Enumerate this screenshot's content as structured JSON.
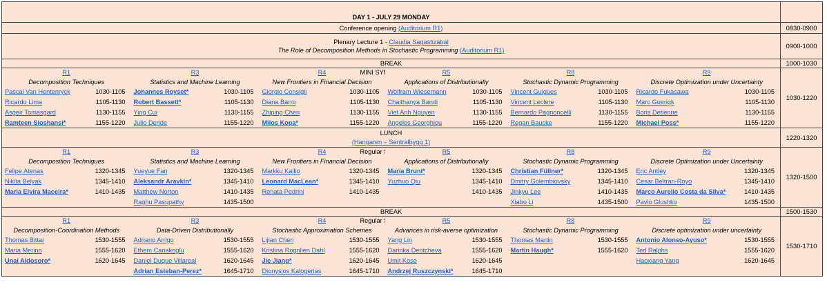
{
  "day_title": "DAY 1 - JULY 29 MONDAY",
  "opening": {
    "text": "Conference opening",
    "room": "(Auditorium R1)",
    "time": "0830-0900"
  },
  "plenary": {
    "line1_prefix": "Plenary Lecture 1 -",
    "speaker": "Claudia Sagastizábal",
    "title": "The Role of Decomposition Methods in Stochastic Programming",
    "room": "(Auditorium R1)",
    "time": "0900-1000"
  },
  "break1": {
    "label": "BREAK",
    "time": "1000-1030"
  },
  "block1": {
    "center": "MINI SYMPOSIA",
    "time": "1030-1220",
    "rooms": [
      "R1",
      "R3",
      "R4",
      "R5",
      "R8",
      "R9"
    ],
    "tracks": [
      "Decomposition Techniques",
      "Statistics and Machine Learning",
      "New Frontiers in Financial Decision",
      "Applications of Distributionally",
      "Stochastic Dynamic Programming",
      "Discrete Optimization under Uncertainty"
    ],
    "rows": [
      [
        {
          "n": "Pascal Van Hentenryck",
          "t": "1030-1105"
        },
        {
          "n": "Johannes Royset*",
          "t": "1030-1105",
          "b": true
        },
        {
          "n": "Giorgio Consigli",
          "t": "1030-1105"
        },
        {
          "n": "Wolfram Wiesemann",
          "t": "1030-1105"
        },
        {
          "n": "Vincent Guigues",
          "t": "1030-1105"
        },
        {
          "n": "Ricardo Fukasawa",
          "t": "1030-1105"
        }
      ],
      [
        {
          "n": "Ricardo Lima",
          "t": "1105-1130"
        },
        {
          "n": "Robert Bassett*",
          "t": "1105-1130",
          "b": true
        },
        {
          "n": "Diana Barro",
          "t": "1105-1130"
        },
        {
          "n": "Chaithanya Bandi",
          "t": "1105-1130"
        },
        {
          "n": "Vincent Leclere",
          "t": "1105-1130"
        },
        {
          "n": "Marc Goerigk",
          "t": "1105-1130"
        }
      ],
      [
        {
          "n": "Asgeir Tomasgard",
          "t": "1130-1155"
        },
        {
          "n": "Ying Cui",
          "t": "1130-1155"
        },
        {
          "n": "Zhiping Chen",
          "t": "1130-1155"
        },
        {
          "n": "Viet Anh Nguyen",
          "t": "1130-1155"
        },
        {
          "n": "Bernardo Pagnoncelli",
          "t": "1130-1155"
        },
        {
          "n": "Boris Detienne",
          "t": "1130-1155"
        }
      ],
      [
        {
          "n": "Ramteen Sioshansi*",
          "t": "1155-1220",
          "b": true
        },
        {
          "n": "Julio Deride",
          "t": "1155-1220"
        },
        {
          "n": "Milos Kopa*",
          "t": "1155-1220",
          "b": true
        },
        {
          "n": "Angelos Georghiou",
          "t": "1155-1220"
        },
        {
          "n": "Regan Baucke",
          "t": "1155-1220"
        },
        {
          "n": "Michael Poss*",
          "t": "1155-1220",
          "b": true
        }
      ]
    ]
  },
  "lunch": {
    "label": "LUNCH",
    "place": "(Hangaren – Sentralbygg 1)",
    "time": "1220-1320"
  },
  "block2": {
    "center": "Regular Session",
    "time": "1320-1500",
    "rooms": [
      "R1",
      "R3",
      "R4",
      "R5",
      "R8",
      "R9"
    ],
    "tracks": [
      "Decomposition Techniques",
      "Statistics and Machine Learning",
      "New Frontiers in Financial Decision",
      "Applications of Distributionally",
      "Stochastic Dynamic Programming",
      "Discrete Optimization under Uncertainty"
    ],
    "rows": [
      [
        {
          "n": "Felipe Atenas",
          "t": "1320-1345"
        },
        {
          "n": "Yueyue Fan",
          "t": "1320-1345"
        },
        {
          "n": "Markku Kallio",
          "t": "1320-1345"
        },
        {
          "n": "Maria Bruni*",
          "t": "1320-1345",
          "b": true
        },
        {
          "n": "Christian Füllner*",
          "t": "1320-1345",
          "b": true
        },
        {
          "n": "Eric Antley",
          "t": "1320-1345"
        }
      ],
      [
        {
          "n": "Nikita Belyak",
          "t": "1345-1410"
        },
        {
          "n": "Aleksandr Aravkin*",
          "t": "1345-1410",
          "b": true
        },
        {
          "n": "Leonard MacLean*",
          "t": "1345-1410",
          "b": true
        },
        {
          "n": "Yuzhuo Qiu",
          "t": "1345-1410"
        },
        {
          "n": "Dmitry Golembiovsky",
          "t": "1345-1410"
        },
        {
          "n": "Cesar Beltran-Royo",
          "t": "1345-1410"
        }
      ],
      [
        {
          "n": "Maria Elvira Maceira*",
          "t": "1410-1435",
          "b": true
        },
        {
          "n": "Matthew Norton",
          "t": "1410-1435"
        },
        {
          "n": "Renata Pedrini",
          "t": "1410-1435"
        },
        {
          "n": "",
          "t": "1410-1435"
        },
        {
          "n": "Jinkyu Lee",
          "t": "1410-1435"
        },
        {
          "n": "Marco Aurelio Costa da Silva*",
          "t": "1410-1435",
          "b": true
        }
      ],
      [
        {
          "n": "",
          "t": ""
        },
        {
          "n": "Raghu Pasupathy",
          "t": "1435-1500"
        },
        {
          "n": "",
          "t": ""
        },
        {
          "n": "",
          "t": ""
        },
        {
          "n": "Xiabo Li",
          "t": "1435-1500"
        },
        {
          "n": "Pavlo Glushko",
          "t": "1435-1500"
        }
      ]
    ]
  },
  "break2": {
    "label": "BREAK",
    "time": "1500-1530"
  },
  "block3": {
    "center": "Regular Session",
    "time": "1530-1710",
    "rooms": [
      "R1",
      "R3",
      "R4",
      "R5",
      "R8",
      "R9"
    ],
    "tracks": [
      "Decomposition-Coordination Methods",
      "Data-Driven Distributionally",
      "Stochastic Approximation Schemes",
      "Advances in risk-averse optimization",
      "Stochastic Dynamic Programming",
      "Discrete optimization under uncertainty"
    ],
    "rows": [
      [
        {
          "n": "Thomas Bittar",
          "t": "1530-1555"
        },
        {
          "n": "Adriano Arrigo",
          "t": "1530-1555"
        },
        {
          "n": "Lijian Chen",
          "t": "1530-1555"
        },
        {
          "n": "Yang Lin",
          "t": "1530-1555"
        },
        {
          "n": "Thomas Martin",
          "t": "1530-1555"
        },
        {
          "n": "Antonio Alonso-Ayuso*",
          "t": "1530-1555",
          "b": true
        }
      ],
      [
        {
          "n": "Maria Merino",
          "t": "1555-1620"
        },
        {
          "n": "Ethem Canakoglu",
          "t": "1555-1620"
        },
        {
          "n": "Kristina Rognlien Dahl",
          "t": "1555-1620"
        },
        {
          "n": "Darinka Dentcheva",
          "t": "1555-1620"
        },
        {
          "n": "Martin Haugh*",
          "t": "1555-1620",
          "b": true
        },
        {
          "n": "Ted Ralphs",
          "t": "1555-1620"
        }
      ],
      [
        {
          "n": "Unai Aldosoro*",
          "t": "1620-1645",
          "b": true
        },
        {
          "n": "Daniel Duque Villareal",
          "t": "1620-1645"
        },
        {
          "n": "Jie Jiang*",
          "t": "1620-1645",
          "b": true
        },
        {
          "n": "Umit Kose",
          "t": "1620-1645"
        },
        {
          "n": "",
          "t": ""
        },
        {
          "n": "Haoxiang Yang",
          "t": "1620-1645"
        }
      ],
      [
        {
          "n": "",
          "t": ""
        },
        {
          "n": "Adrian Esteban-Perez*",
          "t": "1645-1710",
          "b": true
        },
        {
          "n": "Dionysios Kalogerias",
          "t": "1645-1710"
        },
        {
          "n": "Andrzej Ruszczynski*",
          "t": "1645-1710",
          "b": true
        },
        {
          "n": "",
          "t": ""
        },
        {
          "n": "",
          "t": ""
        }
      ]
    ]
  }
}
